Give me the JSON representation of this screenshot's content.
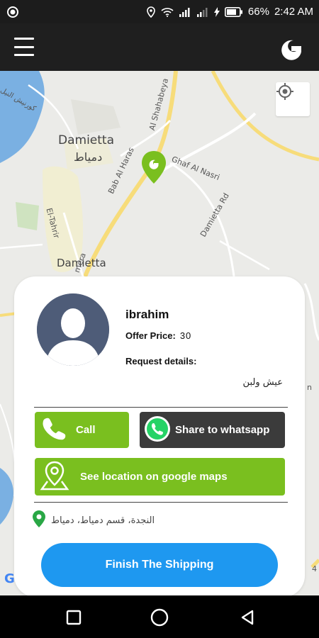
{
  "status_bar": {
    "battery": "66%",
    "time": "2:42 AM"
  },
  "map": {
    "city_label_en": "Damietta",
    "city_label_ar": "دمياط",
    "city_label2": "Damietta",
    "streets": {
      "bab_al_haras": "Bab Al Haras",
      "al_shahabeya": "Al Shahabeya",
      "ghaf_al_nasri": "Ghaf Al Nasri",
      "damietta_rd": "Damietta Rd",
      "el_tahrir": "El-Tahrir",
      "corniche": "كورنيش النيل",
      "bottom_road": "mera",
      "right_edge_1": "n",
      "right_edge_2": "4"
    },
    "google_badge": "G"
  },
  "card": {
    "name": "ibrahim",
    "offer_price_label": "Offer Price:",
    "offer_price_value": "30",
    "request_details_label": "Request details:",
    "request_details_text": "عيش ولبن",
    "call_label": "Call",
    "whatsapp_label": "Share to whatsapp",
    "maps_label": "See location on google maps",
    "address": "النجدة، قسم دمياط، دمياط",
    "finish_label": "Finish The Shipping"
  },
  "colors": {
    "accent_green": "#7abf1f",
    "finish_blue": "#1e98f0",
    "whatsapp_dark": "#3b3b3b",
    "app_bar": "#1f1f1f"
  },
  "icons": {
    "status": [
      "notification-dot-icon",
      "location-icon",
      "wifi-icon",
      "signal-icon",
      "signal-icon",
      "charging-icon",
      "battery-icon"
    ],
    "app_bar": [
      "hamburger-menu-icon",
      "g-logo-icon"
    ],
    "card": [
      "avatar-placeholder-icon",
      "phone-icon",
      "whatsapp-icon",
      "map-pin-icon",
      "location-pin-icon"
    ],
    "nav": [
      "recents-square-icon",
      "home-circle-icon",
      "back-triangle-icon"
    ]
  }
}
